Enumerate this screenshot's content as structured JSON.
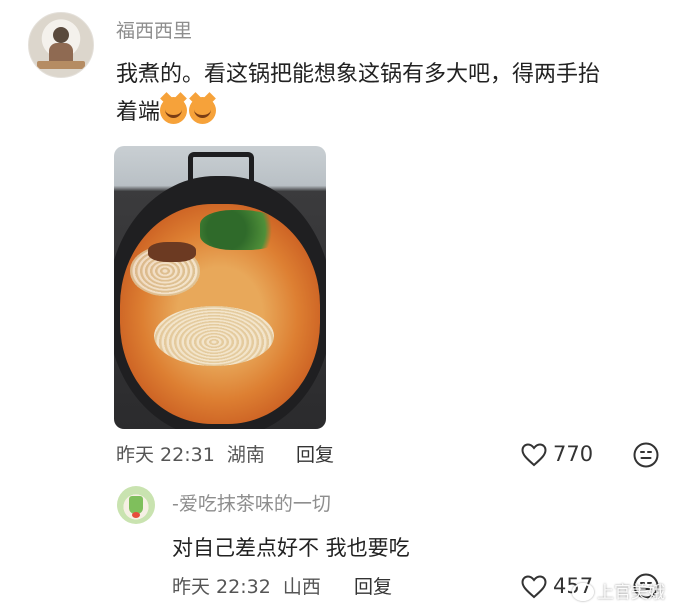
{
  "comment": {
    "username": "福西西里",
    "text_line1": "我煮的。看这锅把能想象这锅有多大吧，得两手抬",
    "text_line2": "着端",
    "emojis": [
      "angry-cat-emoji",
      "angry-cat-emoji"
    ],
    "photo_icon": "hotpot-photo",
    "time": "昨天 22:31",
    "location": "湖南",
    "reply_label": "回复",
    "like_count": "770"
  },
  "reply": {
    "username": "-爱吃抹茶味的一切",
    "text": "对自己差点好不 我也要吃",
    "time": "昨天 22:32",
    "location": "山西",
    "reply_label": "回复",
    "like_count": "457"
  },
  "watermark": "上官美娥",
  "colors": {
    "secondary_text": "#8e8e8e",
    "primary_text": "#222222",
    "meta_text": "#555555"
  }
}
